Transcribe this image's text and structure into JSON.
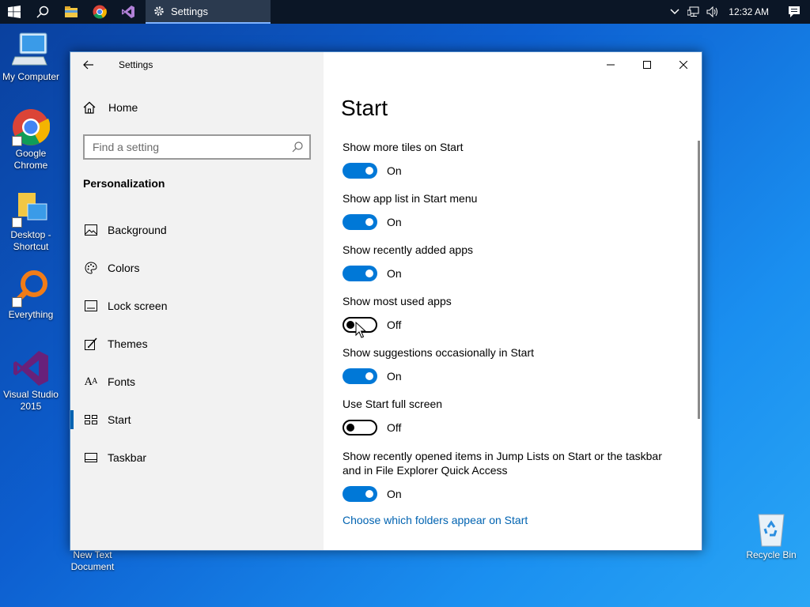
{
  "taskbar": {
    "active_window_label": "Settings",
    "clock": "12:32 AM",
    "icons": [
      "start-icon",
      "search-icon",
      "file-explorer-icon",
      "chrome-icon",
      "visual-studio-icon"
    ]
  },
  "desktop": {
    "icons": [
      {
        "label": "My Computer"
      },
      {
        "label": "Google Chrome"
      },
      {
        "label": "Desktop - Shortcut"
      },
      {
        "label": "Everything"
      },
      {
        "label": "Visual Studio 2015"
      },
      {
        "label": "New Text Document"
      },
      {
        "label": "Recycle Bin"
      }
    ]
  },
  "window": {
    "app_title": "Settings",
    "home_label": "Home",
    "search_placeholder": "Find a setting",
    "section_title": "Personalization",
    "nav": [
      {
        "label": "Background",
        "icon": "image-icon"
      },
      {
        "label": "Colors",
        "icon": "palette-icon"
      },
      {
        "label": "Lock screen",
        "icon": "lock-screen-icon"
      },
      {
        "label": "Themes",
        "icon": "themes-icon"
      },
      {
        "label": "Fonts",
        "icon": "fonts-icon"
      },
      {
        "label": "Start",
        "icon": "start-layout-icon",
        "selected": true
      },
      {
        "label": "Taskbar",
        "icon": "taskbar-icon"
      }
    ]
  },
  "page": {
    "title": "Start",
    "settings": [
      {
        "label": "Show more tiles on Start",
        "state": "On"
      },
      {
        "label": "Show app list in Start menu",
        "state": "On"
      },
      {
        "label": "Show recently added apps",
        "state": "On"
      },
      {
        "label": "Show most used apps",
        "state": "Off"
      },
      {
        "label": "Show suggestions occasionally in Start",
        "state": "On"
      },
      {
        "label": "Use Start full screen",
        "state": "Off"
      },
      {
        "label": "Show recently opened items in Jump Lists on Start or the taskbar and in File Explorer Quick Access",
        "state": "On"
      }
    ],
    "link": "Choose which folders appear on Start"
  },
  "colors": {
    "accent": "#0078d7",
    "link": "#0063b1",
    "taskbar": "#0b1626"
  }
}
